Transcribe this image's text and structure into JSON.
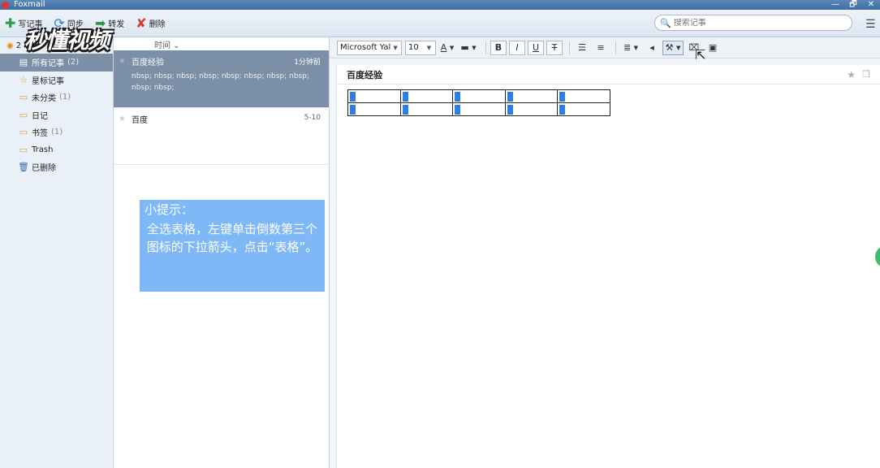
{
  "window": {
    "title": "Foxmail",
    "minimize": "—",
    "restore": "🗗",
    "close": "✕"
  },
  "toolbar": {
    "new_note": "写记事",
    "sync": "同步",
    "forward": "转发",
    "delete": "删除",
    "search_placeholder": "搜索记事",
    "menu_glyph": "☰"
  },
  "watermark": "秒懂视频",
  "sidebar": {
    "account": "2",
    "items": [
      {
        "label": "所有记事",
        "count": "(2)",
        "icon": "note-icon",
        "glyph": "▤"
      },
      {
        "label": "星标记事",
        "count": "",
        "icon": "star-icon",
        "glyph": "☆"
      },
      {
        "label": "未分类",
        "count": "(1)",
        "icon": "folder-icon",
        "glyph": "▭"
      },
      {
        "label": "日记",
        "count": "",
        "icon": "folder-icon",
        "glyph": "▭"
      },
      {
        "label": "书签",
        "count": "(1)",
        "icon": "folder-icon",
        "glyph": "▭"
      },
      {
        "label": "Trash",
        "count": "",
        "icon": "folder-icon",
        "glyph": "▭"
      },
      {
        "label": "已删除",
        "count": "",
        "icon": "trash-icon",
        "glyph": "🗑"
      }
    ]
  },
  "notelist": {
    "sort_label": "时间 ⌄",
    "notes": [
      {
        "title": "百度经验",
        "time": "1分钟前",
        "snippet": "nbsp; nbsp; nbsp; nbsp; nbsp; nbsp; nbsp; nbsp; nbsp; nbsp;"
      },
      {
        "title": "百度",
        "time": "5-10",
        "snippet": ""
      }
    ]
  },
  "tip": {
    "title": "小提示：",
    "body": "全选表格，左键单击倒数第三个图标的下拉箭头，点击“表格”。"
  },
  "editor": {
    "font_family": "Microsoft Yal",
    "font_size": "10",
    "doc_title": "百度经验",
    "table": {
      "rows": 2,
      "cols": 5
    }
  },
  "colors": {
    "accent": "#7b8fa6",
    "tip_bg": "#7fb8f7",
    "cell_mark": "#2e7ce6"
  }
}
